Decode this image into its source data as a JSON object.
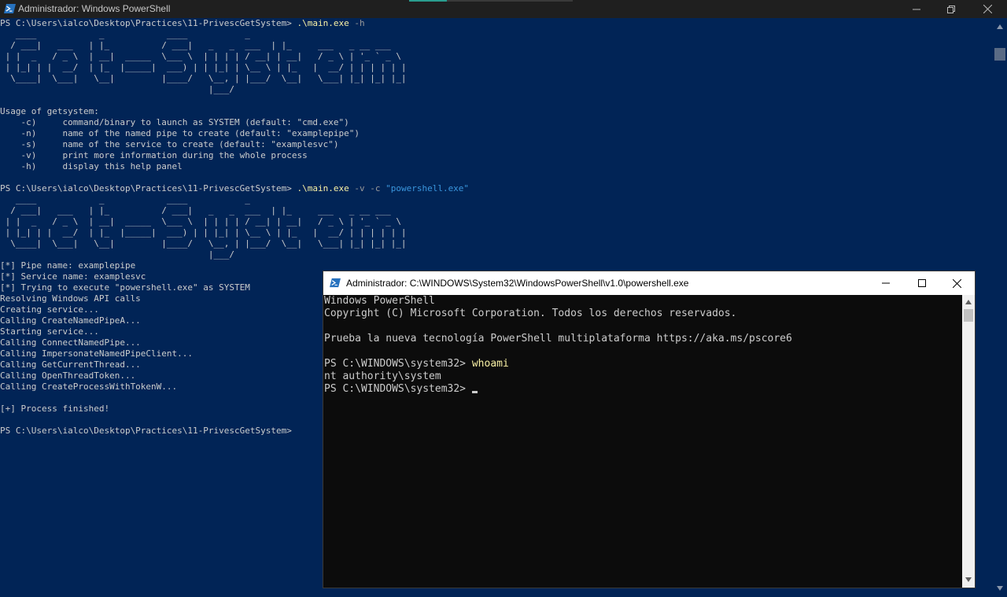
{
  "main_window": {
    "title": "Administrador: Windows PowerShell",
    "lines": [
      [
        {
          "t": "PS C:\\Users\\ialco\\Desktop\\Practices\\11-PrivescGetSystem> "
        },
        {
          "t": ".\\main.exe",
          "c": "cmd"
        },
        {
          "t": " -h",
          "c": "arg"
        }
      ],
      [
        {
          "t": "   ____            _            ____           _"
        }
      ],
      [
        {
          "t": "  / ___|   ___   | |_          / ___|   _   _  ___  | |_     ___   _ __ ___"
        }
      ],
      [
        {
          "t": " | |  _   / _ \\  | __|  _____  \\___ \\  | | | | / __| | __|   / _ \\ | '_ ` _ \\"
        }
      ],
      [
        {
          "t": " | |_| | |  __/  | |_  |_____|  ___) | | |_| | \\__ \\ | |_   |  __/ | | | | | |"
        }
      ],
      [
        {
          "t": "  \\____|  \\___|   \\__|         |____/   \\__, | |___/  \\__|   \\___| |_| |_| |_|"
        }
      ],
      [
        {
          "t": "                                        |___/"
        }
      ],
      [
        {
          "t": ""
        }
      ],
      [
        {
          "t": "Usage of getsystem:"
        }
      ],
      [
        {
          "t": "    -c)     command/binary to launch as SYSTEM (default: \"cmd.exe\")"
        }
      ],
      [
        {
          "t": "    -n)     name of the named pipe to create (default: \"examplepipe\")"
        }
      ],
      [
        {
          "t": "    -s)     name of the service to create (default: \"examplesvc\")"
        }
      ],
      [
        {
          "t": "    -v)     print more information during the whole process"
        }
      ],
      [
        {
          "t": "    -h)     display this help panel"
        }
      ],
      [
        {
          "t": ""
        }
      ],
      [
        {
          "t": "PS C:\\Users\\ialco\\Desktop\\Practices\\11-PrivescGetSystem> "
        },
        {
          "t": ".\\main.exe",
          "c": "cmd"
        },
        {
          "t": " -v -c ",
          "c": "arg"
        },
        {
          "t": "\"powershell.exe\"",
          "c": "str"
        }
      ],
      [
        {
          "t": "   ____            _            ____           _"
        }
      ],
      [
        {
          "t": "  / ___|   ___   | |_          / ___|   _   _  ___  | |_     ___   _ __ ___"
        }
      ],
      [
        {
          "t": " | |  _   / _ \\  | __|  _____  \\___ \\  | | | | / __| | __|   / _ \\ | '_ ` _ \\"
        }
      ],
      [
        {
          "t": " | |_| | |  __/  | |_  |_____|  ___) | | |_| | \\__ \\ | |_   |  __/ | | | | | |"
        }
      ],
      [
        {
          "t": "  \\____|  \\___|   \\__|         |____/   \\__, | |___/  \\__|   \\___| |_| |_| |_|"
        }
      ],
      [
        {
          "t": "                                        |___/"
        }
      ],
      [
        {
          "t": "[*] Pipe name: examplepipe"
        }
      ],
      [
        {
          "t": "[*] Service name: examplesvc"
        }
      ],
      [
        {
          "t": "[*] Trying to execute \"powershell.exe\" as SYSTEM"
        }
      ],
      [
        {
          "t": "Resolving Windows API calls"
        }
      ],
      [
        {
          "t": "Creating service..."
        }
      ],
      [
        {
          "t": "Calling CreateNamedPipeA..."
        }
      ],
      [
        {
          "t": "Starting service..."
        }
      ],
      [
        {
          "t": "Calling ConnectNamedPipe..."
        }
      ],
      [
        {
          "t": "Calling ImpersonateNamedPipeClient..."
        }
      ],
      [
        {
          "t": "Calling GetCurrentThread..."
        }
      ],
      [
        {
          "t": "Calling OpenThreadToken..."
        }
      ],
      [
        {
          "t": "Calling CreateProcessWithTokenW..."
        }
      ],
      [
        {
          "t": ""
        }
      ],
      [
        {
          "t": "[+] Process finished!"
        }
      ],
      [
        {
          "t": ""
        }
      ],
      [
        {
          "t": "PS C:\\Users\\ialco\\Desktop\\Practices\\11-PrivescGetSystem>"
        }
      ]
    ]
  },
  "child_window": {
    "title": "Administrador: C:\\WINDOWS\\System32\\WindowsPowerShell\\v1.0\\powershell.exe",
    "lines": [
      [
        {
          "t": "Windows PowerShell"
        }
      ],
      [
        {
          "t": "Copyright (C) Microsoft Corporation. Todos los derechos reservados."
        }
      ],
      [
        {
          "t": ""
        }
      ],
      [
        {
          "t": "Prueba la nueva tecnología PowerShell multiplataforma https://aka.ms/pscore6"
        }
      ],
      [
        {
          "t": ""
        }
      ],
      [
        {
          "t": "PS C:\\WINDOWS\\system32> "
        },
        {
          "t": "whoami",
          "c": "cmd2"
        }
      ],
      [
        {
          "t": "nt authority\\system"
        }
      ],
      [
        {
          "t": "PS C:\\WINDOWS\\system32> "
        }
      ]
    ]
  },
  "colors": {
    "console_bg": "#012456",
    "child_bg": "#0c0c0c",
    "command": "#f9f1a5",
    "argument": "#9a9a9a",
    "string": "#3a96dd"
  },
  "icons": {
    "app": "powershell-icon",
    "minimize": "minimize-icon",
    "maximize": "maximize-icon",
    "restore": "restore-icon",
    "close": "close-icon"
  }
}
